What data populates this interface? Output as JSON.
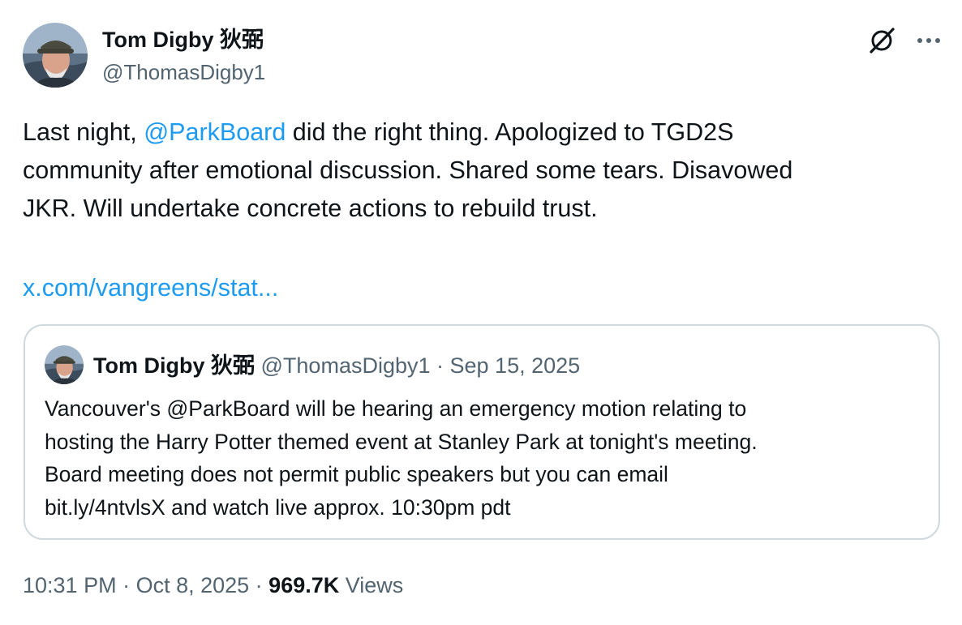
{
  "author": {
    "name": "Tom Digby 狄弼",
    "handle": "@ThomasDigby1"
  },
  "icons": {
    "grok": "grok-icon",
    "more": "more-icon",
    "avatar": "avatar"
  },
  "tweet": {
    "line1_before": "Last night, ",
    "line1_mention": "@ParkBoard",
    "line1_after": " did the right thing.  Apologized to TGD2S",
    "line2": "community after emotional discussion.  Shared some tears.  Disavowed",
    "line3": "JKR. Will undertake concrete actions to rebuild trust.",
    "link": "x.com/vangreens/stat..."
  },
  "quote": {
    "name": "Tom Digby 狄弼",
    "handle": "@ThomasDigby1",
    "separator": " · ",
    "date": "Sep 15, 2025",
    "lines": [
      "Vancouver's @ParkBoard will be hearing an emergency motion relating to",
      "hosting the Harry Potter themed event at Stanley Park at tonight's meeting.",
      "Board meeting does not permit public speakers but you can email",
      "bit.ly/4ntvlsX and watch live approx. 10:30pm pdt"
    ]
  },
  "meta": {
    "time": "10:31 PM",
    "separator": " · ",
    "date": "Oct 8, 2025",
    "views_count": "969.7K",
    "views_label": " Views"
  },
  "colors": {
    "link": "#1d9bf0",
    "secondary_text": "#536471",
    "primary_text": "#0f1419",
    "border": "#cfd9de"
  }
}
